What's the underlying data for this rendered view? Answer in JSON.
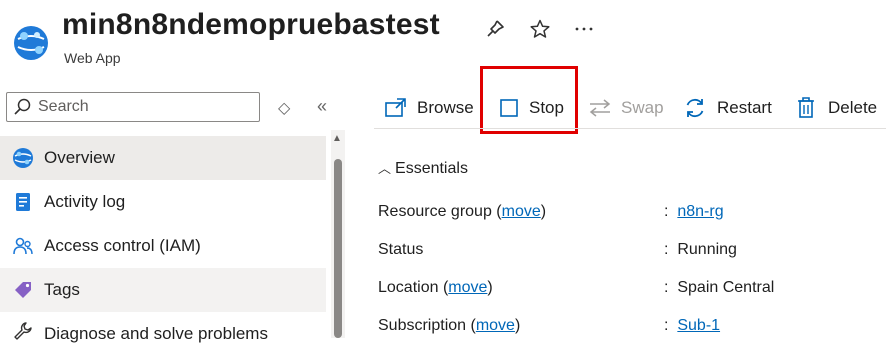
{
  "header": {
    "title": "min8n8ndemopruebastest",
    "subtitle": "Web App",
    "icons": [
      "pin-icon",
      "star-icon",
      "more-icon"
    ]
  },
  "sidebar": {
    "search_placeholder": "Search",
    "items": [
      {
        "label": "Overview",
        "icon": "globe-icon",
        "state": "selected"
      },
      {
        "label": "Activity log",
        "icon": "log-icon",
        "state": "normal"
      },
      {
        "label": "Access control (IAM)",
        "icon": "people-icon",
        "state": "normal"
      },
      {
        "label": "Tags",
        "icon": "tag-icon",
        "state": "hovered"
      },
      {
        "label": "Diagnose and solve problems",
        "icon": "wrench-icon",
        "state": "normal"
      }
    ]
  },
  "toolbar": {
    "browse": "Browse",
    "stop": "Stop",
    "swap": "Swap",
    "restart": "Restart",
    "delete": "Delete"
  },
  "essentials": {
    "toggle_label": "Essentials",
    "rows": [
      {
        "label": "Resource group",
        "action": "move",
        "value": "n8n-rg",
        "value_is_link": true
      },
      {
        "label": "Status",
        "action": "",
        "value": "Running",
        "value_is_link": false
      },
      {
        "label": "Location",
        "action": "move",
        "value": "Spain Central",
        "value_is_link": false
      },
      {
        "label": "Subscription",
        "action": "move",
        "value": "Sub-1",
        "value_is_link": true
      }
    ]
  },
  "colors": {
    "accent": "#0067b8",
    "highlight_border": "#e00000",
    "selected_bg": "#edebe9"
  }
}
